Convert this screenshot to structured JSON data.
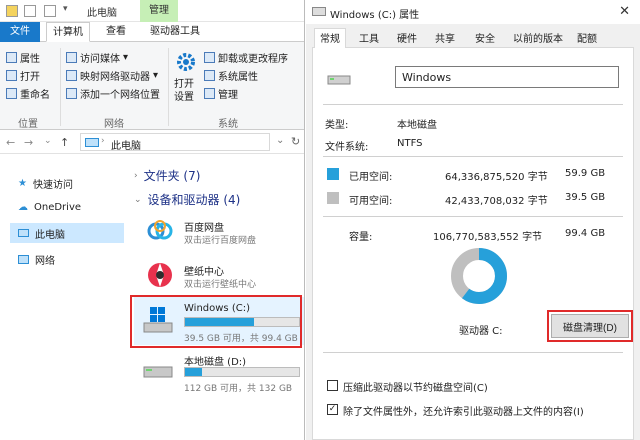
{
  "explorer": {
    "title": "此电脑",
    "manage_tab": "管理",
    "tabs": [
      "文件",
      "计算机",
      "查看",
      "驱动器工具"
    ],
    "ribbon": {
      "location": {
        "items": [
          "属性",
          "打开",
          "重命名"
        ],
        "group": "位置"
      },
      "network": {
        "items": [
          "访问媒体",
          "映射网络驱动器",
          "添加一个网络位置"
        ],
        "group": "网络"
      },
      "system": {
        "open_settings": "打开\n设置",
        "items": [
          "卸载或更改程序",
          "系统属性",
          "管理"
        ],
        "group": "系统"
      }
    },
    "address": "此电脑",
    "sidebar": [
      "快速访问",
      "OneDrive",
      "此电脑",
      "网络"
    ],
    "groups": {
      "folders": "文件夹 (7)",
      "devices": "设备和驱动器 (4)"
    },
    "drives": [
      {
        "name": "百度网盘",
        "sub": "双击运行百度网盘"
      },
      {
        "name": "壁纸中心",
        "sub": "双击运行壁纸中心"
      },
      {
        "name": "Windows (C:)",
        "sub": "39.5 GB 可用，共 99.4 GB",
        "used": 0.603
      },
      {
        "name": "本地磁盘 (D:)",
        "sub": "112 GB 可用，共 132 GB",
        "used": 0.152
      }
    ]
  },
  "props": {
    "title": "Windows (C:) 属性",
    "close": "✕",
    "tabs": [
      "常规",
      "工具",
      "硬件",
      "共享",
      "安全",
      "以前的版本",
      "配额"
    ],
    "name_value": "Windows",
    "type_label": "类型:",
    "type_value": "本地磁盘",
    "fs_label": "文件系统:",
    "fs_value": "NTFS",
    "used_label": "已用空间:",
    "used_bytes": "64,336,875,520 字节",
    "used_gb": "59.9 GB",
    "free_label": "可用空间:",
    "free_bytes": "42,433,708,032 字节",
    "free_gb": "39.5 GB",
    "cap_label": "容量:",
    "cap_bytes": "106,770,583,552 字节",
    "cap_gb": "99.4 GB",
    "drive_label": "驱动器 C:",
    "cleanup_button": "磁盘清理(D)",
    "compress_label": "压缩此驱动器以节约磁盘空间(C)",
    "index_label": "除了文件属性外，还允许索引此驱动器上文件的内容(I)",
    "used_fraction": 0.603,
    "colors": {
      "used": "#26a0da",
      "free": "#bfbfbf"
    }
  }
}
